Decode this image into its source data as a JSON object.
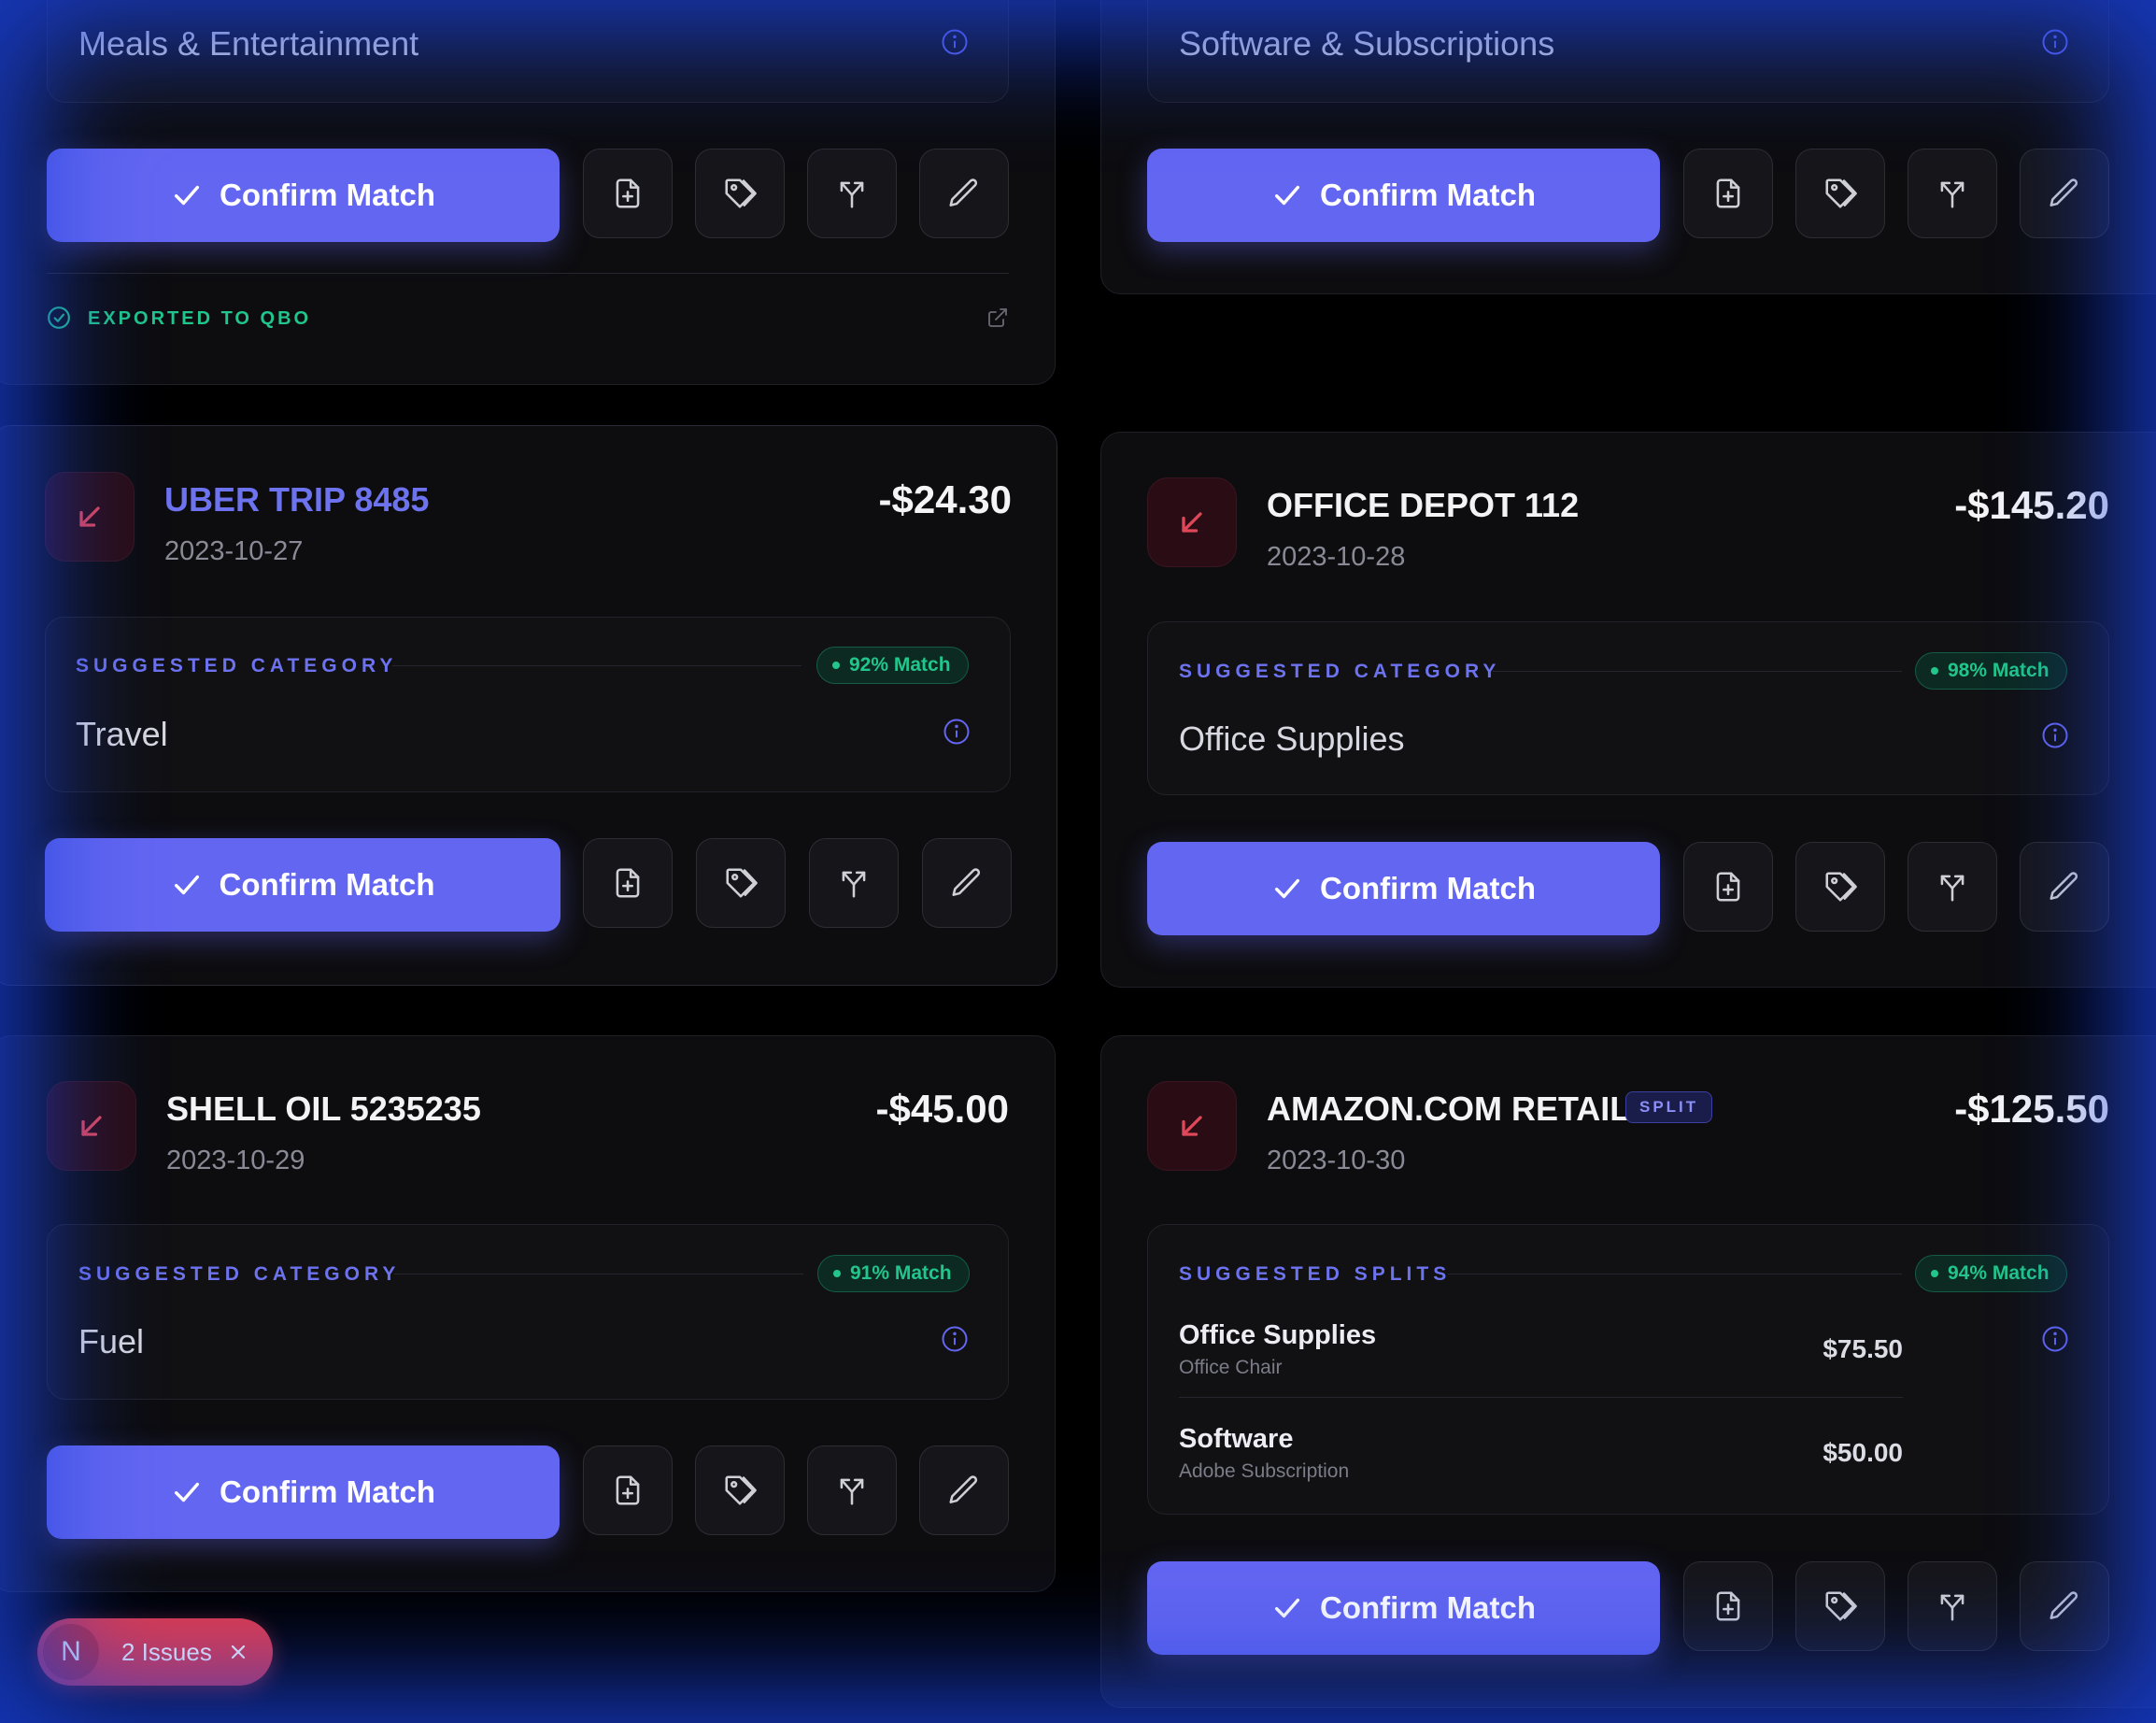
{
  "colors": {
    "accent": "#6366f1",
    "success": "#22c58b",
    "danger": "#e23b4a",
    "background": "#000000",
    "glow": "#1e46e6"
  },
  "common": {
    "confirm_label": "Confirm Match",
    "suggested_category_label": "SUGGESTED CATEGORY",
    "suggested_splits_label": "SUGGESTED SPLITS"
  },
  "top_left": {
    "category": "Meals & Entertainment",
    "export_status": "EXPORTED TO QBO"
  },
  "top_right": {
    "category": "Software & Subscriptions"
  },
  "uber": {
    "vendor": "UBER TRIP 8485",
    "date": "2023-10-27",
    "amount": "-$24.30",
    "match": "92% Match",
    "category": "Travel"
  },
  "office_depot": {
    "vendor": "OFFICE DEPOT 112",
    "date": "2023-10-28",
    "amount": "-$145.20",
    "match": "98% Match",
    "category": "Office Supplies"
  },
  "shell": {
    "vendor": "SHELL OIL 5235235",
    "date": "2023-10-29",
    "amount": "-$45.00",
    "match": "91% Match",
    "category": "Fuel"
  },
  "amazon": {
    "vendor": "AMAZON.COM RETAIL",
    "tag": "SPLIT",
    "date": "2023-10-30",
    "amount": "-$125.50",
    "match": "94% Match",
    "splits": [
      {
        "name": "Office Supplies",
        "sub": "Office Chair",
        "amount": "$75.50"
      },
      {
        "name": "Software",
        "sub": "Adobe Subscription",
        "amount": "$50.00"
      }
    ]
  },
  "issues": {
    "avatar_letter": "N",
    "label": "2 Issues"
  },
  "icons": [
    "check-icon",
    "file-plus-icon",
    "tag-icon",
    "split-icon",
    "pencil-icon",
    "info-icon",
    "arrow-down-left-icon",
    "external-link-icon",
    "check-circle-icon",
    "close-icon"
  ]
}
